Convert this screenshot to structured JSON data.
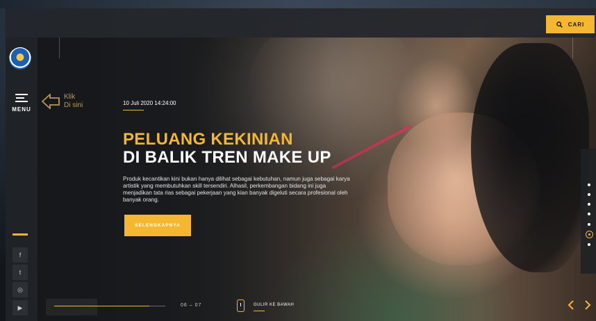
{
  "header": {
    "search_label": "CARI",
    "search_icon": "search-icon"
  },
  "sidebar": {
    "logo": "tut-wuri-handayani-logo",
    "menu_label": "MENU",
    "social": [
      {
        "name": "facebook-icon",
        "glyph": "f"
      },
      {
        "name": "twitter-icon",
        "glyph": "t"
      },
      {
        "name": "instagram-icon",
        "glyph": "◎"
      },
      {
        "name": "youtube-icon",
        "glyph": "▶"
      }
    ]
  },
  "hint": {
    "line1": "Klik",
    "line2": "Di sini"
  },
  "article": {
    "date": "10 Juli 2020 14:24:00",
    "title_line1": "PELUANG KEKINIAN",
    "title_line2": "DI BALIK TREN MAKE UP",
    "description": "Produk kecantikan kini bukan hanya dilihat sebagai kebutuhan, namun juga sebagai karya artistik yang membutuhkan skill tersendiri. Alhasil, perkembangan bidang ini juga menjadikan tata rias sebagai pekerjaan yang kian banyak digeluti secara profesional oleh banyak orang.",
    "cta_label": "SELENGKAPNYA"
  },
  "slider": {
    "counter": "06  –  07",
    "progress": 0.857,
    "scroll_label": "GULIR KE BAWAH",
    "pager_count": 7,
    "pager_active": 6
  },
  "colors": {
    "accent": "#f5b731",
    "dark": "#1f2328"
  }
}
